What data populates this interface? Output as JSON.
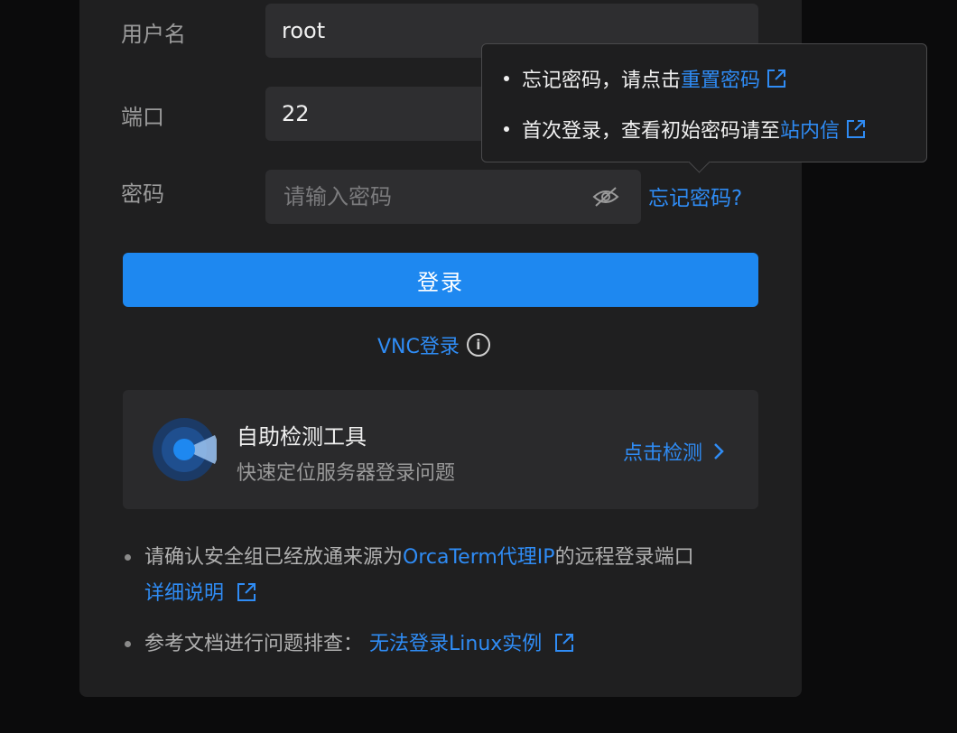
{
  "form": {
    "username_label": "用户名",
    "username_value": "root",
    "port_label": "端口",
    "port_value": "22",
    "password_label": "密码",
    "password_placeholder": "请输入密码",
    "forgot_link": "忘记密码?",
    "login_button": "登录",
    "vnc_link": "VNC登录"
  },
  "tooltip": {
    "row1_text": "忘记密码，请点击",
    "row1_link": "重置密码",
    "row2_text": "首次登录，查看初始密码请至",
    "row2_link": "站内信"
  },
  "tool": {
    "title": "自助检测工具",
    "subtitle": "快速定位服务器登录问题",
    "action": "点击检测"
  },
  "notes": {
    "note1_text": "请确认安全组已经放通来源为",
    "note1_link": "OrcaTerm代理IP",
    "note1_suffix": "的远程登录端口",
    "note1_detail_link": "详细说明",
    "note2_text": "参考文档进行问题排查：",
    "note2_link": "无法登录Linux实例"
  },
  "colors": {
    "accent": "#1e88f0",
    "link": "#2f8cf5",
    "panel": "#1f1f20",
    "field": "#2e2e30"
  }
}
